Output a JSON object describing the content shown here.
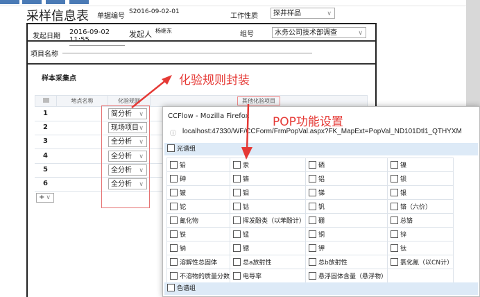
{
  "title": "采样信息表",
  "doc_no_label": "单据编号",
  "doc_no": "S2016-09-02-01",
  "work_type_label": "工作性质",
  "work_type": "探井样品",
  "start_date_label": "发起日期",
  "start_date": "2016-09-02 11:55",
  "initiator_label": "发起人",
  "initiator": "杨继东",
  "group_label": "组号",
  "group": "水务公司技术部调查",
  "project_label": "项目名称",
  "section_title": "样本采集点",
  "table": {
    "headers": [
      "地点名称",
      "化验规则"
    ],
    "other_button": "其他化验项目",
    "rows": [
      {
        "no": "1",
        "rule": "简分析"
      },
      {
        "no": "2",
        "rule": "现场项目"
      },
      {
        "no": "3",
        "rule": "全分析"
      },
      {
        "no": "4",
        "rule": "全分析"
      },
      {
        "no": "5",
        "rule": "全分析"
      },
      {
        "no": "6",
        "rule": "全分析"
      }
    ],
    "add": "+"
  },
  "annotations": {
    "rule": "化验规则封装",
    "pop": "POP功能设置"
  },
  "popup": {
    "title": "CCFlow - Mozilla Firefox",
    "url": "localhost:47330/WF/CCForm/FrmPopVal.aspx?FK_MapExt=PopVal_ND101Dtl1_QTHYXM",
    "group1": "光谱组",
    "group2": "色谱组",
    "items": [
      [
        "铅",
        "汞",
        "硒",
        "镍"
      ],
      [
        "砷",
        "铬",
        "铝",
        "钡"
      ],
      [
        "铍",
        "钼",
        "锑",
        "银"
      ],
      [
        "铊",
        "钴",
        "钒",
        "铬（六价）"
      ],
      [
        "氰化物",
        "挥发酚类（以苯酚计）",
        "硼",
        "总铬"
      ],
      [
        "铁",
        "锰",
        "铜",
        "锌"
      ],
      [
        "钠",
        "锶",
        "钾",
        "钛"
      ],
      [
        "溶解性总固体",
        "总a放射性",
        "总b放射性",
        "氯化氰（以CN计）"
      ],
      [
        "不溶物的质量分数",
        "电导率",
        "悬浮固体含量（悬浮物）",
        ""
      ]
    ]
  },
  "colors": {
    "annotation": "#e53935",
    "group_bg": "#ddeaf7"
  }
}
